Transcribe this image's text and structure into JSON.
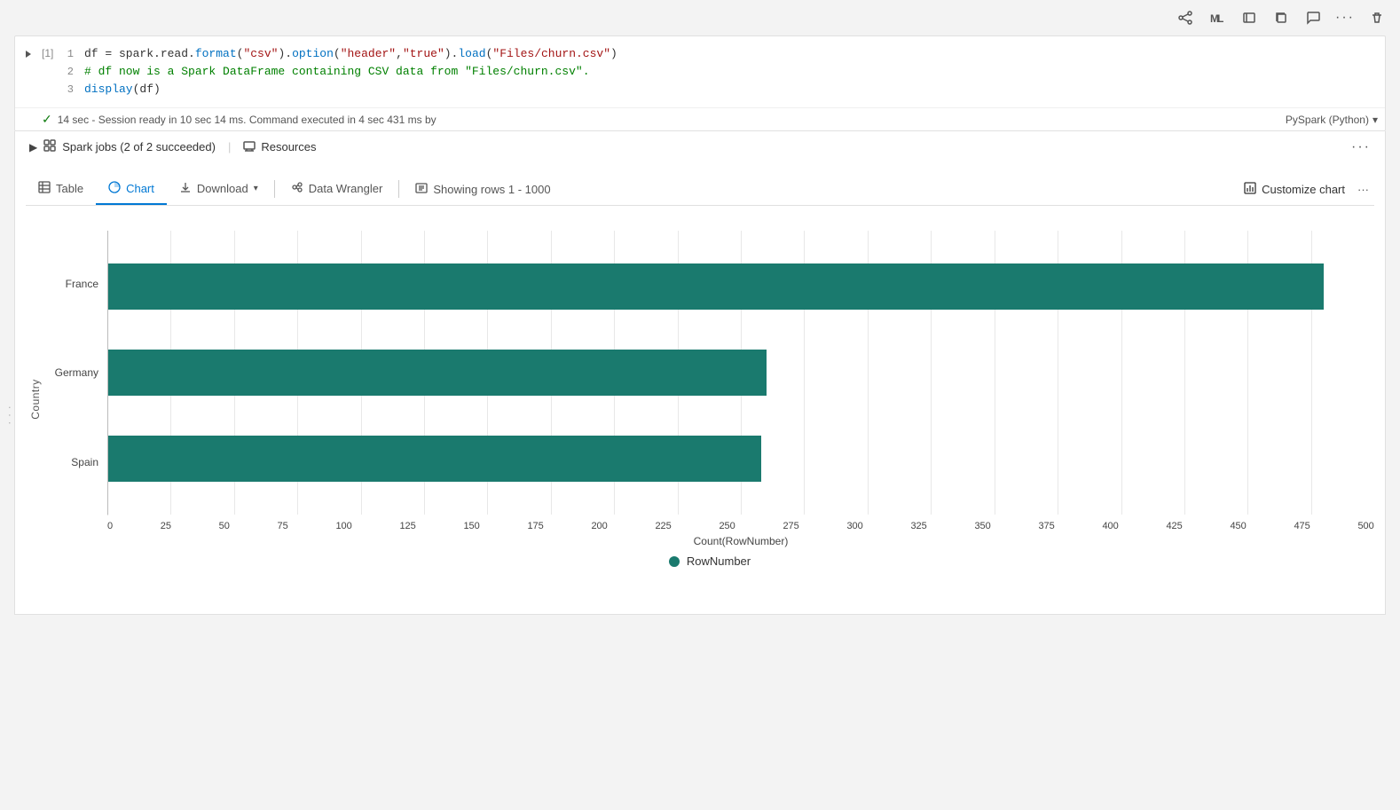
{
  "toolbar": {
    "icons": [
      "share-icon",
      "model-icon",
      "comment-icon",
      "copy-icon",
      "chat-icon",
      "ellipsis-icon",
      "delete-icon"
    ]
  },
  "cell": {
    "number": "[1]",
    "lines": [
      {
        "num": "1",
        "code_html": "<span>df = spark.read.<span class='kw-func'>format</span>(<span class='kw-string'>\"csv\"</span>).<span class='kw-func'>option</span>(<span class='kw-string'>\"header\"</span>,<span class='kw-string'>\"true\"</span>).<span class='kw-func'>load</span>(<span class='kw-string'>\"Files/churn.csv\"</span>)</span>"
      },
      {
        "num": "2",
        "code_html": "<span class='kw-comment'># df now is a Spark DataFrame containing CSV data from \"Files/churn.csv\".</span>"
      },
      {
        "num": "3",
        "code_html": "<span class='kw-func'>display</span>(df)"
      }
    ],
    "status": "14 sec - Session ready in 10 sec 14 ms. Command executed in 4 sec 431 ms by",
    "runtime": "PySpark (Python)"
  },
  "spark_jobs": {
    "label": "Spark jobs (2 of 2 succeeded)",
    "resources_label": "Resources"
  },
  "tabs": {
    "items": [
      {
        "id": "table",
        "label": "Table",
        "icon": "table-icon",
        "active": false
      },
      {
        "id": "chart",
        "label": "Chart",
        "icon": "chart-icon",
        "active": true
      },
      {
        "id": "download",
        "label": "Download",
        "icon": "download-icon",
        "active": false
      }
    ],
    "data_wrangler_label": "Data Wrangler",
    "showing_rows_label": "Showing rows 1 - 1000",
    "customize_chart_label": "Customize chart"
  },
  "chart": {
    "y_axis_label": "Country",
    "x_axis_label": "Count(RowNumber)",
    "y_categories": [
      "France",
      "Germany",
      "Spain"
    ],
    "x_ticks": [
      "0",
      "25",
      "50",
      "75",
      "100",
      "125",
      "150",
      "175",
      "200",
      "225",
      "250",
      "275",
      "300",
      "325",
      "350",
      "375",
      "400",
      "425",
      "450",
      "475",
      "500"
    ],
    "bars": [
      {
        "country": "France",
        "value": 480,
        "max": 500,
        "pct": 96
      },
      {
        "country": "Germany",
        "value": 260,
        "max": 500,
        "pct": 52
      },
      {
        "country": "Spain",
        "value": 258,
        "max": 500,
        "pct": 51.6
      }
    ],
    "legend_label": "RowNumber",
    "bar_color": "#1a7a6e"
  }
}
